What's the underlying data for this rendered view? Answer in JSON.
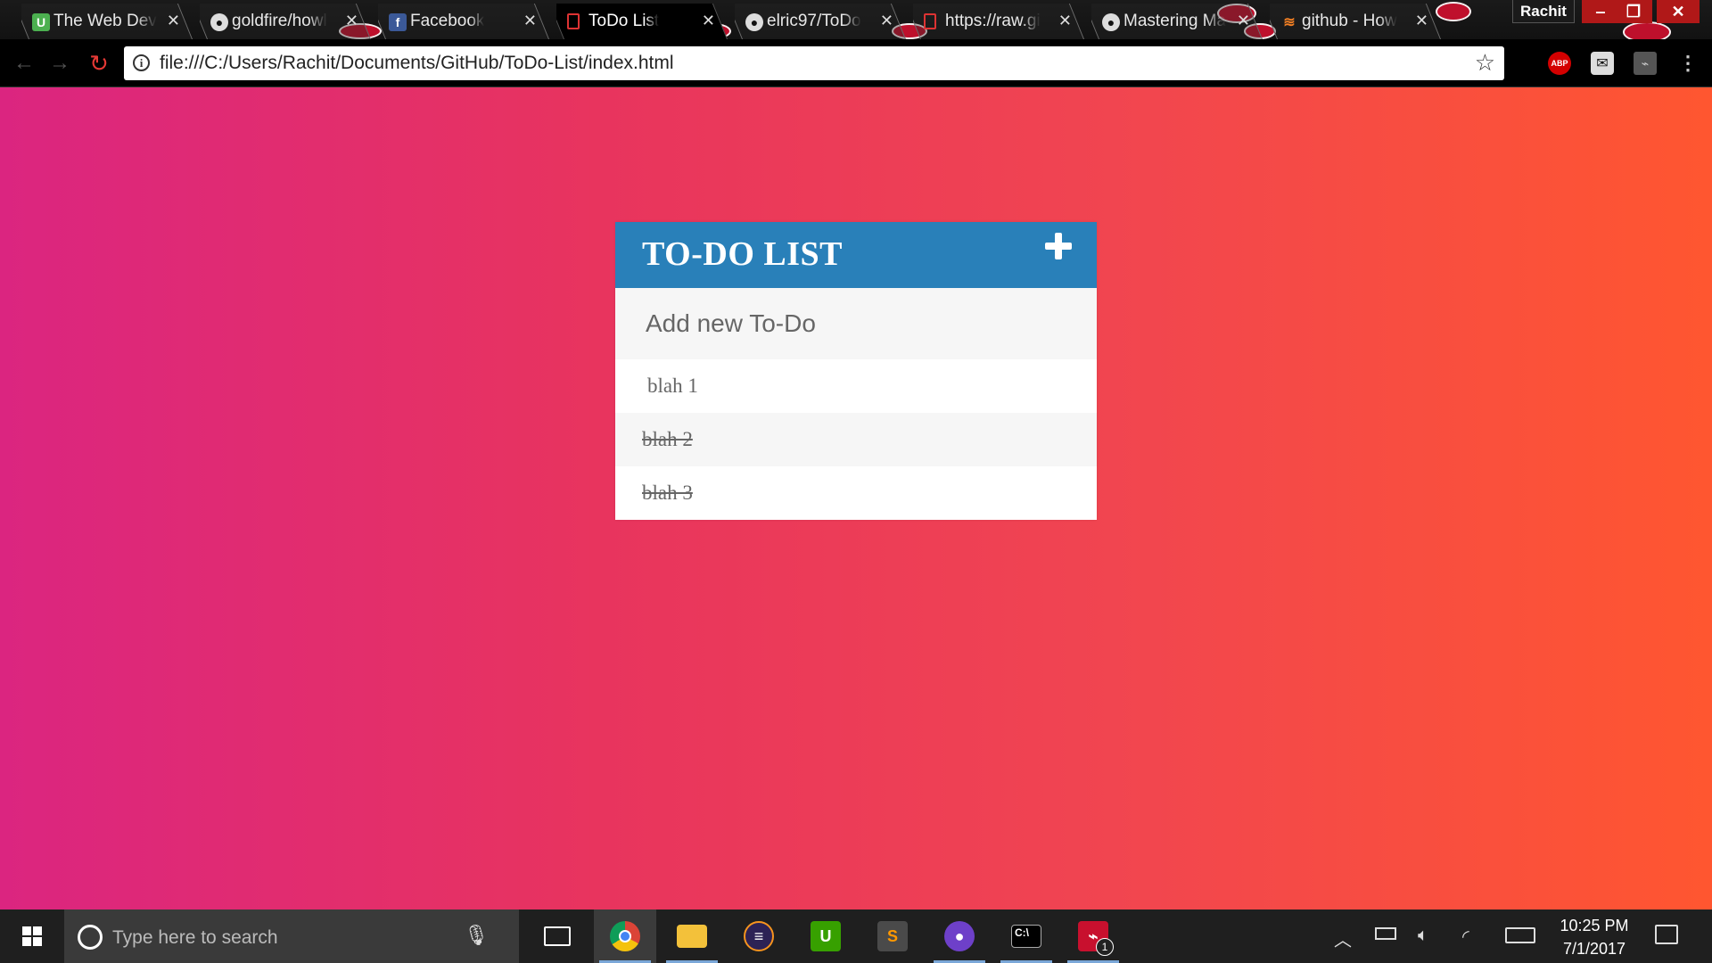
{
  "browser": {
    "tabs": [
      {
        "title": "The Web Dev",
        "icon": "udemy-icon",
        "active": false
      },
      {
        "title": "goldfire/howl",
        "icon": "github-icon",
        "active": false
      },
      {
        "title": "Facebook",
        "icon": "facebook-icon",
        "active": false
      },
      {
        "title": "ToDo List",
        "icon": "page-icon",
        "active": true
      },
      {
        "title": "elric97/ToDo",
        "icon": "github-icon",
        "active": false
      },
      {
        "title": "https://raw.gi",
        "icon": "page-icon",
        "active": false
      },
      {
        "title": "Mastering Ma",
        "icon": "github-icon",
        "active": false
      },
      {
        "title": "github - How",
        "icon": "stackoverflow-icon",
        "active": false
      }
    ],
    "profile_name": "Rachit",
    "url": "file:///C:/Users/Rachit/Documents/GitHub/ToDo-List/index.html",
    "extensions": {
      "abp_label": "ABP"
    }
  },
  "todo": {
    "title": "TO-DO LIST",
    "input_placeholder": "Add new To-Do",
    "items": [
      {
        "text": "blah 1",
        "done": false
      },
      {
        "text": "blah 2",
        "done": true
      },
      {
        "text": "blah 3",
        "done": true
      }
    ]
  },
  "taskbar": {
    "search_placeholder": "Type here to search",
    "acrobat_badge": "1",
    "clock_time": "10:25 PM",
    "clock_date": "7/1/2017"
  },
  "colors": {
    "header": "#2980b9",
    "gradient_start": "#db2580",
    "gradient_end": "#ff5630"
  }
}
